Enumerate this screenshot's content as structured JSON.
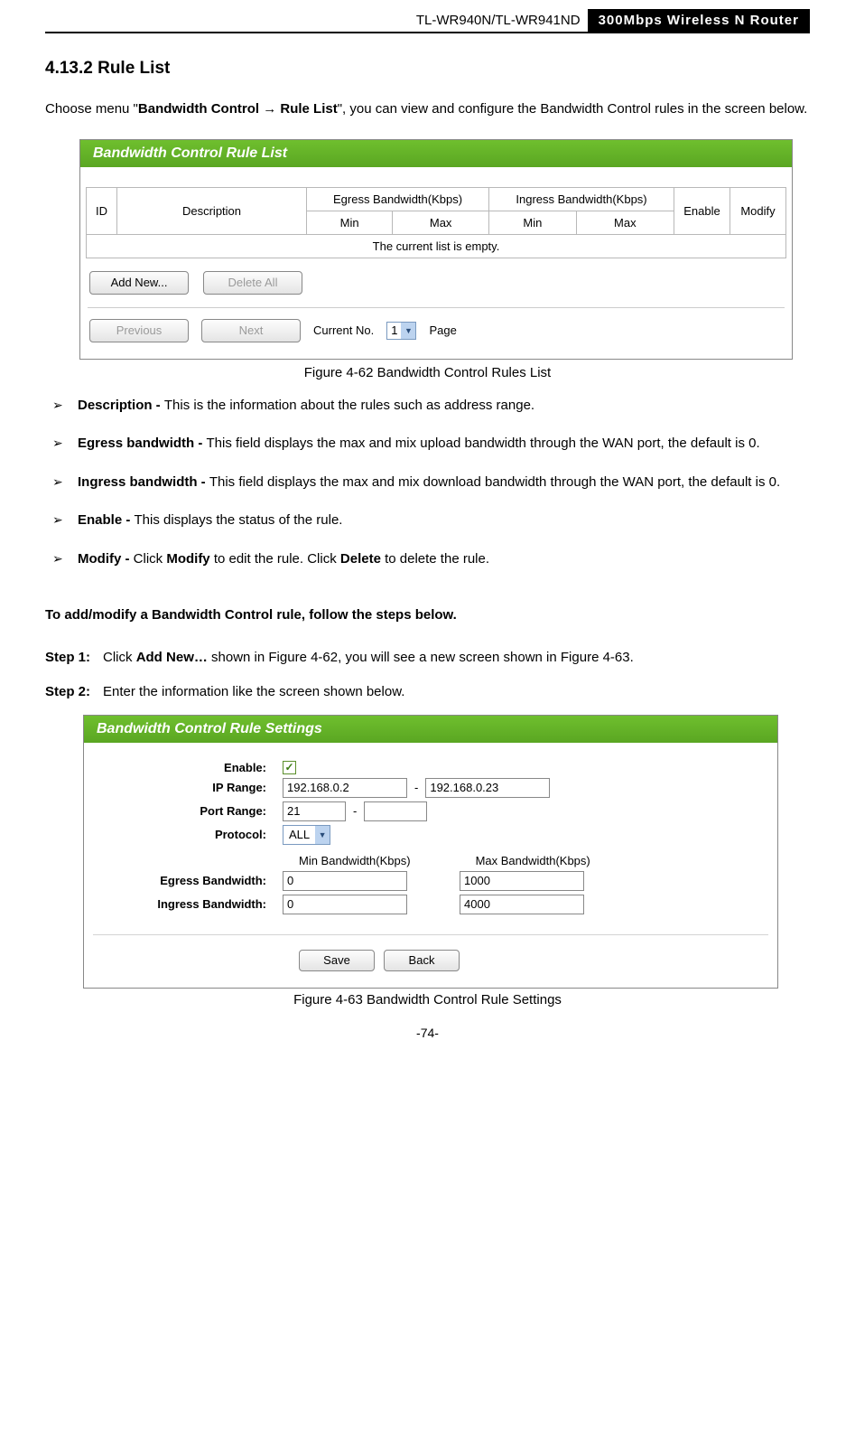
{
  "header": {
    "model": "TL-WR940N/TL-WR941ND",
    "product": "300Mbps Wireless N Router"
  },
  "section_heading": "4.13.2 Rule List",
  "intro": {
    "pre": "Choose menu \"",
    "bold": "Bandwidth Control → Rule List",
    "post": "\", you can view and configure the Bandwidth Control rules in the screen below."
  },
  "fig62": {
    "title": "Bandwidth Control Rule List",
    "cols": {
      "id": "ID",
      "desc": "Description",
      "egress": "Egress Bandwidth(Kbps)",
      "ingress": "Ingress Bandwidth(Kbps)",
      "min": "Min",
      "max": "Max",
      "enable": "Enable",
      "modify": "Modify"
    },
    "empty": "The current list is empty.",
    "btn_addnew": "Add New...",
    "btn_deleteall": "Delete All",
    "btn_prev": "Previous",
    "btn_next": "Next",
    "pager_label1": "Current No.",
    "pager_value": "1",
    "pager_label2": "Page",
    "caption": "Figure 4-62 Bandwidth Control Rules List"
  },
  "bullets": [
    {
      "term": "Description - ",
      "body": "This is the information about the rules such as address range."
    },
    {
      "term": "Egress bandwidth - ",
      "body": "This field displays the max and mix upload bandwidth through the WAN port, the default is 0."
    },
    {
      "term": "Ingress bandwidth - ",
      "body": "This field displays the max and mix download bandwidth through the WAN port, the default is 0."
    },
    {
      "term": "Enable - ",
      "body": "This displays the status of the rule."
    },
    {
      "term": "Modify - ",
      "body_pre": "Click ",
      "body_b1": "Modify",
      "body_mid": " to edit the rule. Click ",
      "body_b2": "Delete",
      "body_post": " to delete the rule."
    }
  ],
  "howto_heading": "To add/modify a Bandwidth Control rule, follow the steps below.",
  "step1": {
    "label": "Step 1:",
    "pre": "Click ",
    "bold": "Add New…",
    "post": " shown in Figure 4-62, you will see a new screen shown in Figure 4-63."
  },
  "step2": {
    "label": "Step 2:",
    "text": "Enter the information like the screen shown below."
  },
  "fig63": {
    "title": "Bandwidth Control Rule Settings",
    "labels": {
      "enable": "Enable:",
      "ip": "IP Range:",
      "port": "Port Range:",
      "proto": "Protocol:",
      "egress": "Egress Bandwidth:",
      "ingress": "Ingress Bandwidth:",
      "minh": "Min Bandwidth(Kbps)",
      "maxh": "Max Bandwidth(Kbps)"
    },
    "values": {
      "ip1": "192.168.0.2",
      "ip2": "192.168.0.23",
      "port1": "21",
      "port2": "",
      "proto": "ALL",
      "eg_min": "0",
      "eg_max": "1000",
      "in_min": "0",
      "in_max": "4000"
    },
    "btn_save": "Save",
    "btn_back": "Back",
    "caption": "Figure 4-63 Bandwidth Control Rule Settings"
  },
  "page_number": "-74-"
}
